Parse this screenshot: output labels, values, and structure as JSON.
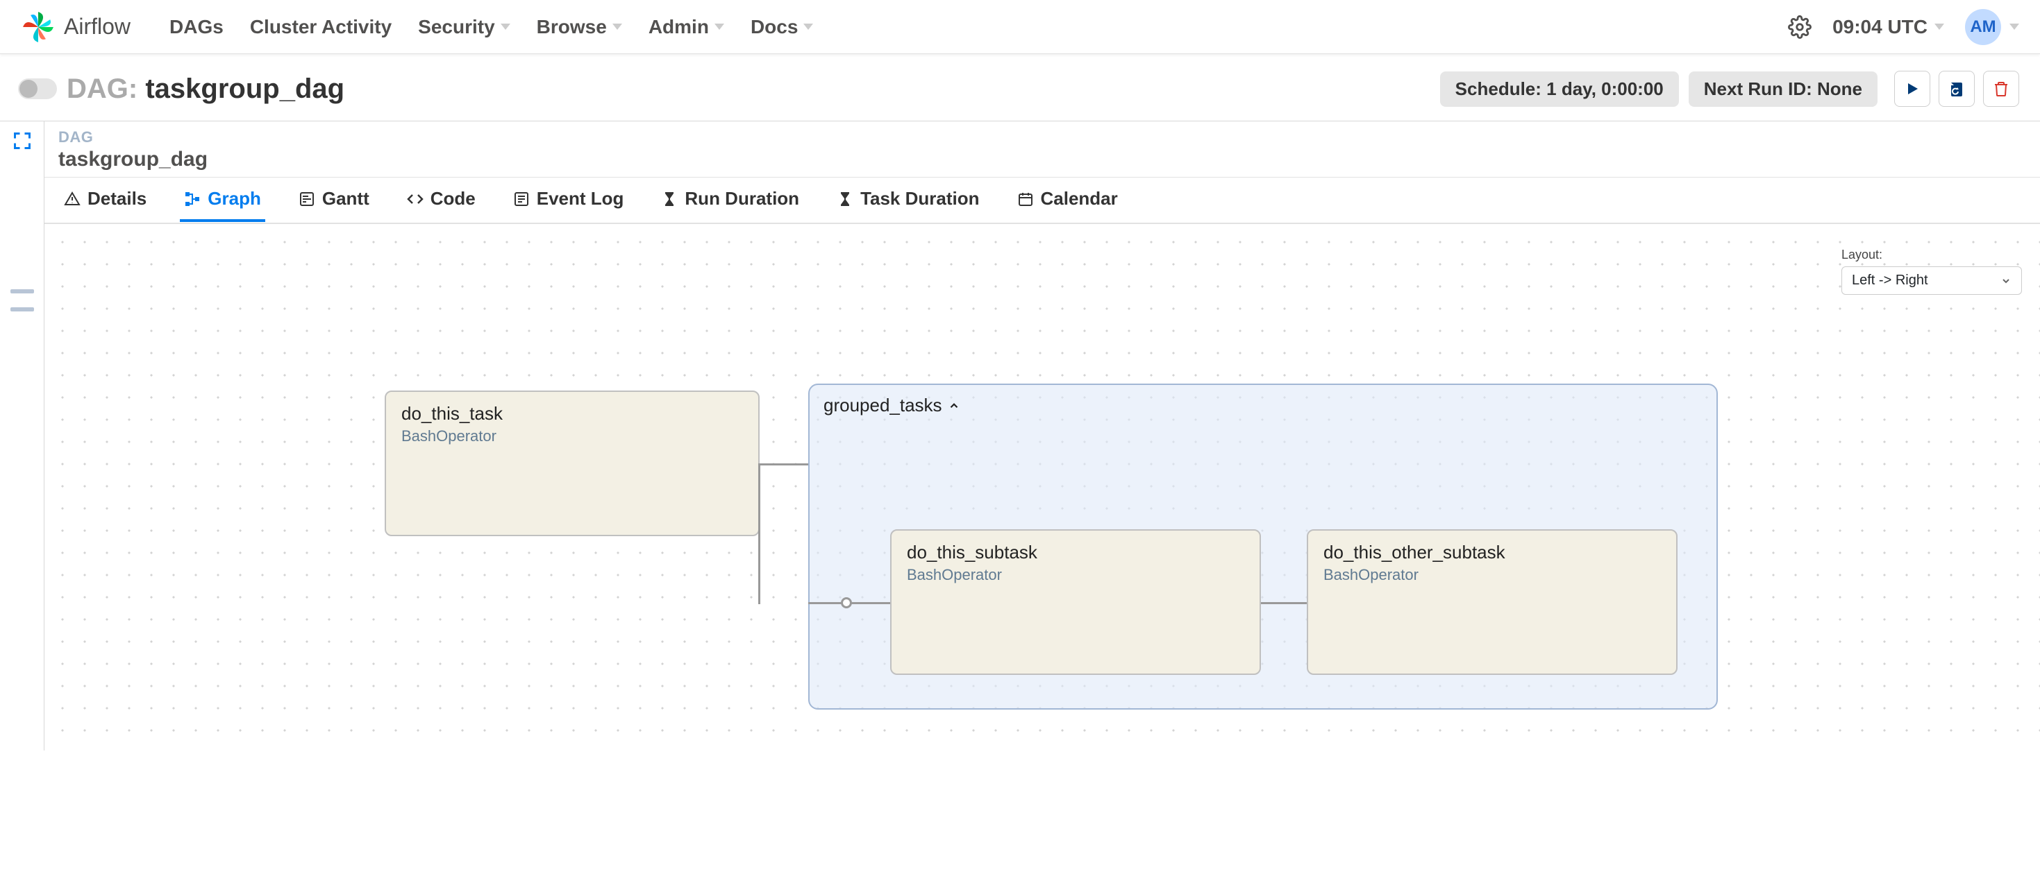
{
  "brand": "Airflow",
  "nav": {
    "items": [
      "DAGs",
      "Cluster Activity",
      "Security",
      "Browse",
      "Admin",
      "Docs"
    ]
  },
  "clock": "09:04 UTC",
  "avatar_initials": "AM",
  "dag_header": {
    "prefix": "DAG:",
    "name": "taskgroup_dag",
    "schedule_pill": "Schedule: 1 day, 0:00:00",
    "next_run_pill": "Next Run ID: None"
  },
  "panel": {
    "subtitle": "DAG",
    "title": "taskgroup_dag"
  },
  "tabs": [
    "Details",
    "Graph",
    "Gantt",
    "Code",
    "Event Log",
    "Run Duration",
    "Task Duration",
    "Calendar"
  ],
  "active_tab": "Graph",
  "layout": {
    "label": "Layout:",
    "value": "Left -> Right"
  },
  "graph": {
    "group_name": "grouped_tasks",
    "nodes": [
      {
        "id": "do_this_task",
        "operator": "BashOperator"
      },
      {
        "id": "do_this_subtask",
        "operator": "BashOperator"
      },
      {
        "id": "do_this_other_subtask",
        "operator": "BashOperator"
      }
    ]
  }
}
